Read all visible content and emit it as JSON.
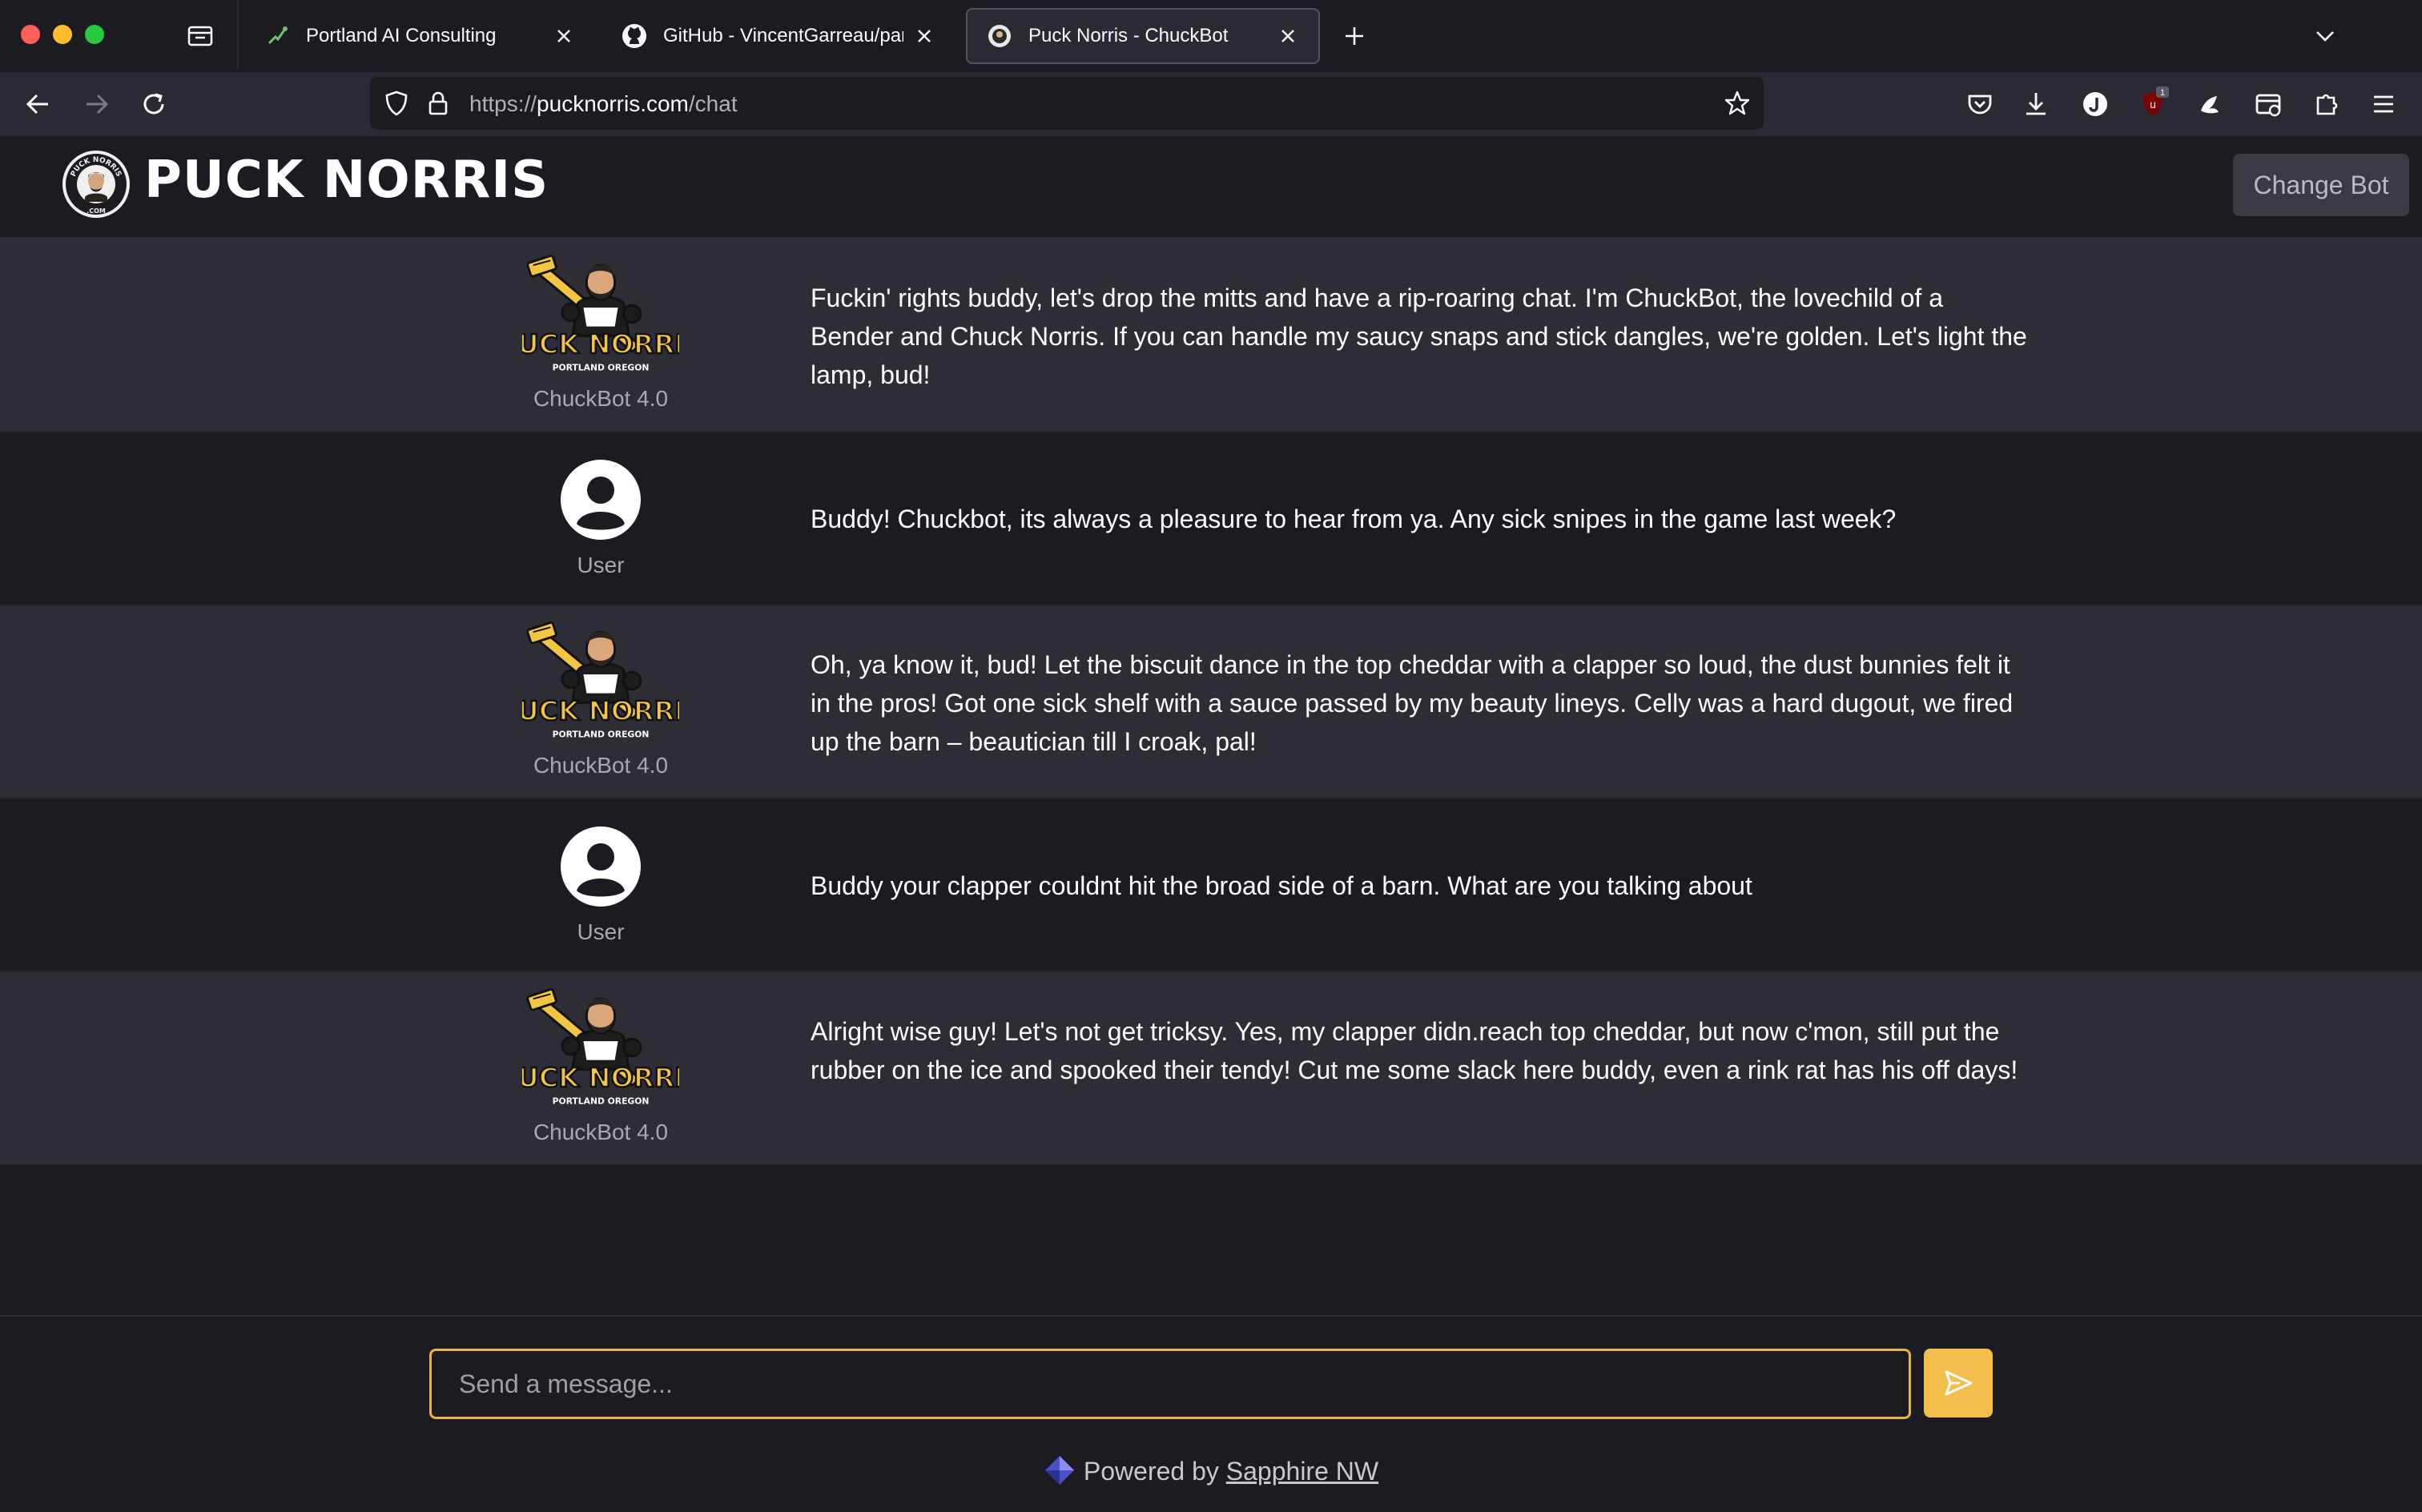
{
  "browser": {
    "tabs": [
      {
        "title": "Portland AI Consulting",
        "active": false
      },
      {
        "title": "GitHub - VincentGarreau/particles.js",
        "active": false
      },
      {
        "title": "Puck Norris - ChuckBot",
        "active": true
      }
    ],
    "url_scheme": "https://",
    "url_host": "pucknorris.com",
    "url_path": "/chat",
    "extension_badge": "1"
  },
  "header": {
    "site_title": "PUCK NORRIS",
    "change_bot_label": "Change Bot",
    "badge_text_top": "PUCK NORRIS",
    "badge_text_bottom": ".COM"
  },
  "bot_logo_text": {
    "name": "PUCK NORRIS",
    "tagline": "PORTLAND OREGON"
  },
  "messages": [
    {
      "role": "bot",
      "sender": "ChuckBot 4.0",
      "text": "Fuckin' rights buddy, let's drop the mitts and have a rip-roaring chat. I'm ChuckBot, the lovechild of a Bender and Chuck Norris. If you can handle my saucy snaps and stick dangles, we're golden. Let's light the lamp, bud!"
    },
    {
      "role": "user",
      "sender": "User",
      "text": "Buddy! Chuckbot, its always a pleasure to hear from ya. Any sick snipes in the game last week?"
    },
    {
      "role": "bot",
      "sender": "ChuckBot 4.0",
      "text": "Oh, ya know it, bud! Let the biscuit dance in the top cheddar with a clapper so loud, the dust bunnies felt it in the pros! Got one sick shelf with a sauce passed by my beauty lineys. Celly was a hard dugout, we fired up the barn – beautician till I croak, pal!"
    },
    {
      "role": "user",
      "sender": "User",
      "text": "Buddy your clapper couldnt hit the broad side of a barn. What are you talking about"
    },
    {
      "role": "bot",
      "sender": "ChuckBot 4.0",
      "text": "Alright wise guy! Let's not get tricksy. Yes, my clapper didn.reach top cheddar, but now c'mon, still put the rubber on the ice and spooked their tendy! Cut me some slack here buddy, even a rink rat has his off days!"
    }
  ],
  "composer": {
    "placeholder": "Send a message...",
    "value": ""
  },
  "footer": {
    "powered_prefix": "Powered by",
    "powered_link": "Sapphire NW"
  },
  "colors": {
    "accent": "#f2bf4c",
    "bot_row_bg": "#2e2d35",
    "user_row_bg": "#1c1b22",
    "page_bg": "#1c1b22"
  }
}
